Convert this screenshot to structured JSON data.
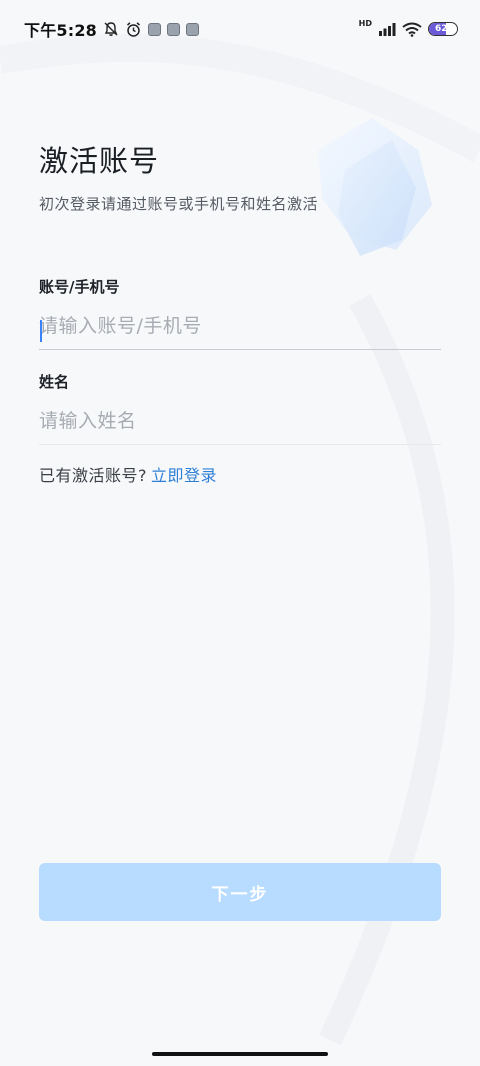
{
  "status_bar": {
    "time": "下午5:28",
    "icons": [
      "mute-bell-icon",
      "alarm-icon",
      "app-notification-icon",
      "app-notification-icon",
      "app-notification-icon"
    ],
    "hd_label": "HD",
    "battery_level": "62",
    "battery_fraction": 0.62,
    "battery_color": "#6b5bd9"
  },
  "header": {
    "title": "激活账号",
    "subtitle": "初次登录请通过账号或手机号和姓名激活"
  },
  "form": {
    "account": {
      "label": "账号/手机号",
      "placeholder": "请输入账号/手机号",
      "value": ""
    },
    "name": {
      "label": "姓名",
      "placeholder": "请输入姓名",
      "value": ""
    }
  },
  "login_hint": {
    "text": "已有激活账号?",
    "link": "立即登录",
    "link_color": "#2f7fd8"
  },
  "next_button": {
    "label": "下一步",
    "color": "#b8dcff"
  }
}
